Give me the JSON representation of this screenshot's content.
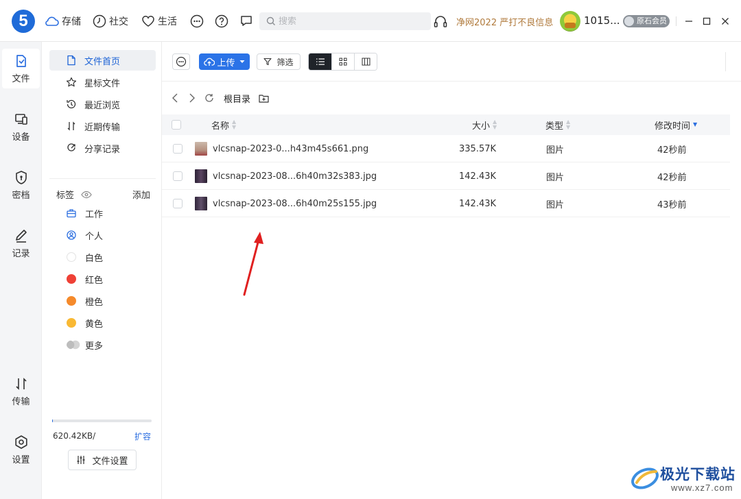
{
  "header": {
    "logo_text": "5",
    "nav": [
      {
        "label": "存储",
        "icon": "cloud-icon"
      },
      {
        "label": "社交",
        "icon": "clock-icon"
      },
      {
        "label": "生活",
        "icon": "heart-icon"
      }
    ],
    "search_placeholder": "搜索",
    "promo": "净网2022 严打不良信息",
    "username": "1015...",
    "vip_label": "原石会员"
  },
  "rail": {
    "items": [
      {
        "label": "文件",
        "icon": "file-icon",
        "active": true
      },
      {
        "label": "设备",
        "icon": "device-icon"
      },
      {
        "label": "密档",
        "icon": "shield-icon"
      },
      {
        "label": "记录",
        "icon": "pen-icon"
      },
      {
        "label": "传输",
        "icon": "transfer-icon"
      },
      {
        "label": "设置",
        "icon": "settings-icon"
      }
    ]
  },
  "sidebar": {
    "nav": [
      {
        "label": "文件首页",
        "icon": "document-icon"
      },
      {
        "label": "星标文件",
        "icon": "star-icon"
      },
      {
        "label": "最近浏览",
        "icon": "history-icon"
      },
      {
        "label": "近期传输",
        "icon": "transfer-icon"
      },
      {
        "label": "分享记录",
        "icon": "share-icon"
      }
    ],
    "tags_title": "标签",
    "tags_add": "添加",
    "tags": [
      {
        "label": "工作",
        "icon": "briefcase-icon"
      },
      {
        "label": "个人",
        "icon": "person-icon"
      },
      {
        "label": "白色",
        "color": "#f2f2f2"
      },
      {
        "label": "红色",
        "color": "#ef4136"
      },
      {
        "label": "橙色",
        "color": "#f58a2b"
      },
      {
        "label": "黄色",
        "color": "#f9b934"
      },
      {
        "label": "更多",
        "color": "#c8c8c8"
      }
    ],
    "storage_text": "620.42KB/",
    "expand_label": "扩容",
    "file_settings_label": "文件设置"
  },
  "toolbar": {
    "upload_label": "上传",
    "filter_label": "筛选"
  },
  "breadcrumb": {
    "root": "根目录"
  },
  "table": {
    "headers": {
      "name": "名称",
      "size": "大小",
      "type": "类型",
      "modified": "修改时间"
    },
    "rows": [
      {
        "name": "vlcsnap-2023-0...h43m45s661.png",
        "size": "335.57K",
        "type": "图片",
        "modified": "42秒前",
        "thumb": "#c9b2a2"
      },
      {
        "name": "vlcsnap-2023-08...6h40m32s383.jpg",
        "size": "142.43K",
        "type": "图片",
        "modified": "42秒前",
        "thumb": "#3b2d44"
      },
      {
        "name": "vlcsnap-2023-08...6h40m25s155.jpg",
        "size": "142.43K",
        "type": "图片",
        "modified": "43秒前",
        "thumb": "#3f3148"
      }
    ]
  },
  "watermark": {
    "title": "极光下载站",
    "url": "www.xz7.com"
  }
}
